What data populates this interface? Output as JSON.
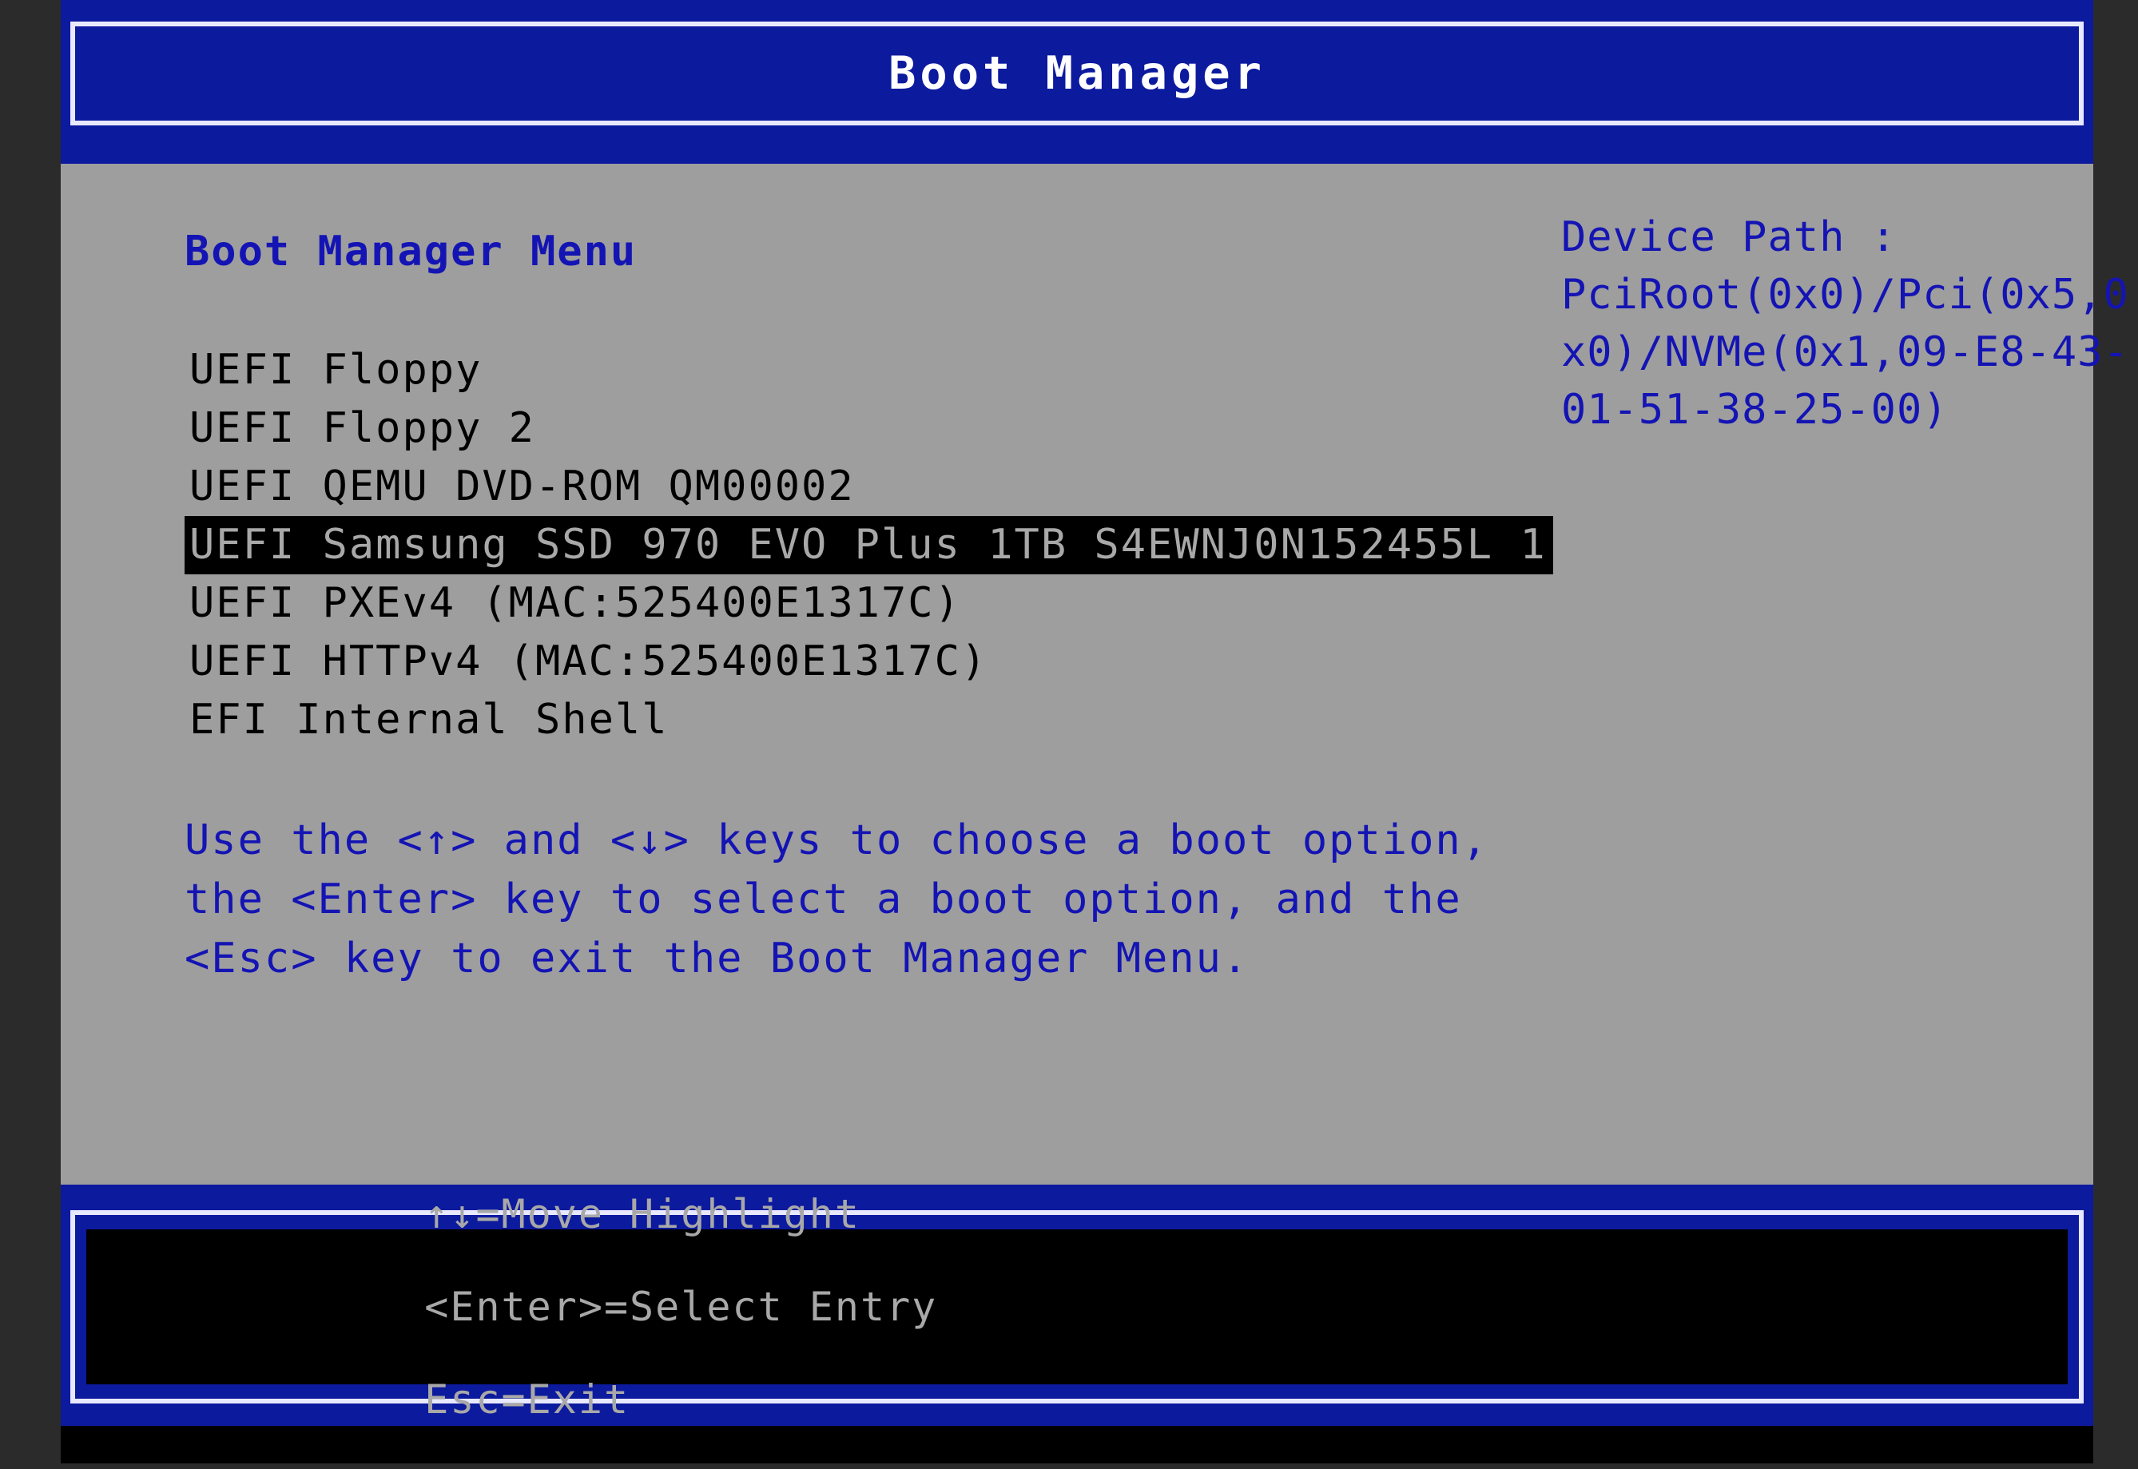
{
  "window": {
    "title": "Boot Manager"
  },
  "colors": {
    "frame_blue": "#0c1a9e",
    "panel_gray": "#9e9e9e",
    "text_blue": "#1414b4",
    "text_black": "#000000",
    "highlight_bg": "#000000",
    "highlight_fg": "#a8a8a8",
    "border_white": "#e8e8ff",
    "outer_margin": "#2b2b2b"
  },
  "main": {
    "menu_heading": "Boot Manager Menu",
    "boot_entries": [
      {
        "label": "UEFI Floppy",
        "selected": false
      },
      {
        "label": "UEFI Floppy 2",
        "selected": false
      },
      {
        "label": "UEFI QEMU DVD-ROM QM00002",
        "selected": false
      },
      {
        "label": "UEFI Samsung SSD 970 EVO Plus 1TB S4EWNJ0N152455L 1",
        "selected": true
      },
      {
        "label": "UEFI PXEv4 (MAC:525400E1317C)",
        "selected": false
      },
      {
        "label": "UEFI HTTPv4 (MAC:525400E1317C)",
        "selected": false
      },
      {
        "label": "EFI Internal Shell",
        "selected": false
      }
    ],
    "help_lines": [
      "Use the <↑> and <↓> keys to choose a boot option,",
      "the <Enter> key to select a boot option, and the",
      "<Esc> key to exit the Boot Manager Menu."
    ]
  },
  "device_path": {
    "label": "Device Path :",
    "lines": [
      "PciRoot(0x0)/Pci(0x5,0",
      "x0)/NVMe(0x1,09-E8-43-",
      "01-51-38-25-00)"
    ]
  },
  "status_bar": {
    "move_highlight": "↑↓=Move Highlight",
    "select_entry": "<Enter>=Select Entry",
    "exit": "Esc=Exit"
  }
}
